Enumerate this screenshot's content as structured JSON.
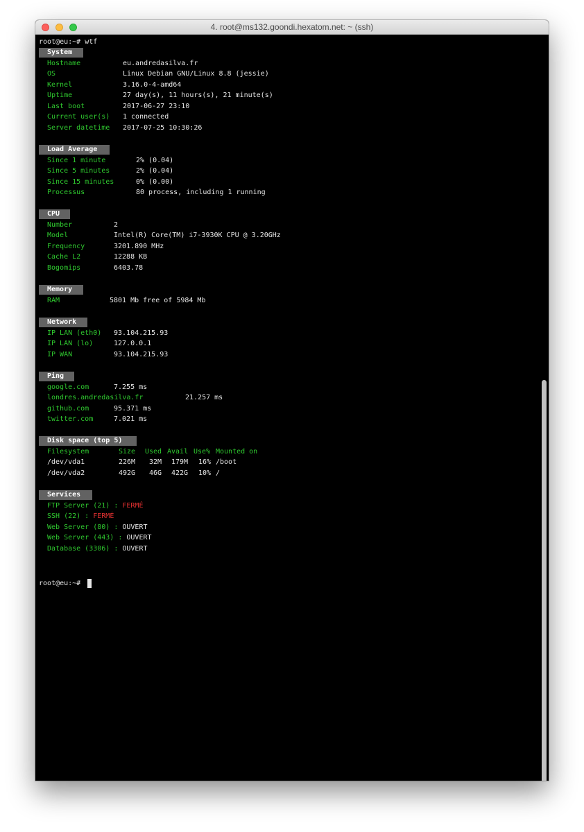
{
  "window_title": "4. root@ms132.goondi.hexatom.net: ~ (ssh)",
  "prompt_command": "root@eu:~# wtf",
  "prompt_end": "root@eu:~# ",
  "colors": {
    "label": "#2fc92f",
    "value": "#e6e6e6",
    "status_closed": "#e03030",
    "header_bg": "#626262",
    "background": "#000000"
  },
  "system": {
    "header": "System",
    "rows": [
      {
        "label": "Hostname",
        "value": "eu.andredasilva.fr"
      },
      {
        "label": "OS",
        "value": "Linux Debian GNU/Linux 8.8 (jessie)"
      },
      {
        "label": "Kernel",
        "value": "3.16.0-4-amd64"
      },
      {
        "label": "Uptime",
        "value": "27 day(s), 11 hours(s), 21 minute(s)"
      },
      {
        "label": "Last boot",
        "value": "2017-06-27 23:10"
      },
      {
        "label": "Current user(s)",
        "value": "1 connected"
      },
      {
        "label": "Server datetime",
        "value": "2017-07-25 10:30:26"
      }
    ]
  },
  "load": {
    "header": "Load Average",
    "rows": [
      {
        "label": "Since 1 minute",
        "value": "2% (0.04)"
      },
      {
        "label": "Since 5 minutes",
        "value": "2% (0.04)"
      },
      {
        "label": "Since 15 minutes",
        "value": "0% (0.00)"
      },
      {
        "label": "Processus",
        "value": "80 process, including 1 running"
      }
    ]
  },
  "cpu": {
    "header": "CPU",
    "rows": [
      {
        "label": "Number",
        "value": "2"
      },
      {
        "label": "Model",
        "value": "Intel(R) Core(TM) i7-3930K CPU @ 3.20GHz"
      },
      {
        "label": "Frequency",
        "value": "3201.890 MHz"
      },
      {
        "label": "Cache L2",
        "value": "12288 KB"
      },
      {
        "label": "Bogomips",
        "value": "6403.78"
      }
    ]
  },
  "memory": {
    "header": "Memory",
    "rows": [
      {
        "label": "RAM",
        "value": "5801 Mb free of 5984 Mb"
      }
    ]
  },
  "network": {
    "header": "Network",
    "rows": [
      {
        "label": "IP LAN (eth0)",
        "value": "93.104.215.93"
      },
      {
        "label": "IP LAN (lo)",
        "value": "127.0.0.1"
      },
      {
        "label": "IP WAN",
        "value": "93.104.215.93"
      }
    ]
  },
  "ping": {
    "header": "Ping",
    "rows": [
      {
        "label": "google.com",
        "value": "7.255 ms"
      },
      {
        "label": "londres.andredasilva.fr",
        "value": "21.257 ms"
      },
      {
        "label": "github.com",
        "value": "95.371 ms"
      },
      {
        "label": "twitter.com",
        "value": "7.021 ms"
      }
    ]
  },
  "disk": {
    "header": "Disk space (top 5)",
    "columns": [
      "Filesystem",
      "Size",
      "Used",
      "Avail",
      "Use%",
      "Mounted on"
    ],
    "rows": [
      [
        "/dev/vda1",
        "226M",
        "32M",
        "179M",
        "16%",
        "/boot"
      ],
      [
        "/dev/vda2",
        "492G",
        "46G",
        "422G",
        "10%",
        "/"
      ]
    ]
  },
  "services": {
    "header": "Services",
    "rows": [
      {
        "label": "FTP Server (21) : ",
        "status": "FERMÉ",
        "state": "closed"
      },
      {
        "label": "SSH (22) : ",
        "status": "FERMÉ",
        "state": "closed"
      },
      {
        "label": "Web Server (80) : ",
        "status": "OUVERT",
        "state": "open"
      },
      {
        "label": "Web Server (443) : ",
        "status": "OUVERT",
        "state": "open"
      },
      {
        "label": "Database (3306) : ",
        "status": "OUVERT",
        "state": "open"
      }
    ]
  }
}
